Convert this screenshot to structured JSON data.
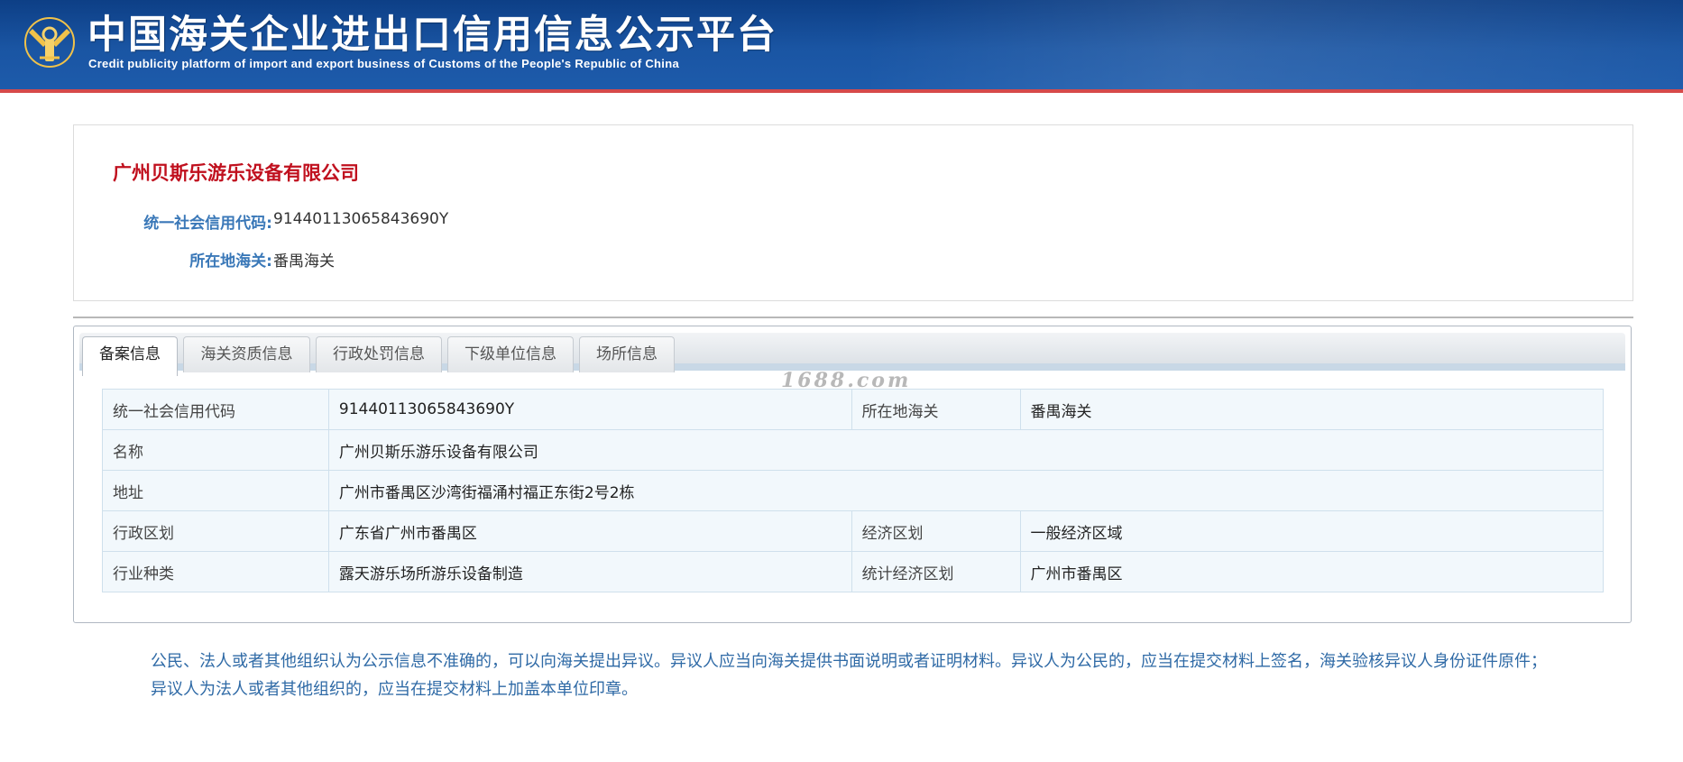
{
  "header": {
    "title_cn": "中国海关企业进出口信用信息公示平台",
    "title_en": "Credit publicity platform of import and export business of Customs of the People's Republic of China",
    "emblem_icon": "customs-emblem-icon"
  },
  "summary": {
    "company_name": "广州贝斯乐游乐设备有限公司",
    "credit_code_label": "统一社会信用代码:",
    "credit_code_value": "91440113065843690Y",
    "customs_label": "所在地海关:",
    "customs_value": "番禺海关"
  },
  "tabs": [
    {
      "label": "备案信息",
      "active": true
    },
    {
      "label": "海关资质信息",
      "active": false
    },
    {
      "label": "行政处罚信息",
      "active": false
    },
    {
      "label": "下级单位信息",
      "active": false
    },
    {
      "label": "场所信息",
      "active": false
    }
  ],
  "watermark": "1688.com",
  "record_table": {
    "r1": {
      "l1": "统一社会信用代码",
      "v1": "91440113065843690Y",
      "l2": "所在地海关",
      "v2": "番禺海关"
    },
    "r2": {
      "l1": "名称",
      "v1": "广州贝斯乐游乐设备有限公司"
    },
    "r3": {
      "l1": "地址",
      "v1": "广州市番禺区沙湾街福涌村福正东街2号2栋"
    },
    "r4": {
      "l1": "行政区划",
      "v1": "广东省广州市番禺区",
      "l2": "经济区划",
      "v2": "一般经济区域"
    },
    "r5": {
      "l1": "行业种类",
      "v1": "露天游乐场所游乐设备制造",
      "l2": "统计经济区划",
      "v2": "广州市番禺区"
    }
  },
  "notice": "公民、法人或者其他组织认为公示信息不准确的，可以向海关提出异议。异议人应当向海关提供书面说明或者证明材料。异议人为公民的，应当在提交材料上签名，海关验核异议人身份证件原件；异议人为法人或者其他组织的，应当在提交材料上加盖本单位印章。",
  "colors": {
    "header_blue": "#1a55a3",
    "header_red_line": "#d64a4a",
    "company_red": "#c0101e",
    "label_blue": "#3a78b8",
    "table_bg": "#f2f8fc",
    "notice_blue": "#2f6aa6"
  }
}
